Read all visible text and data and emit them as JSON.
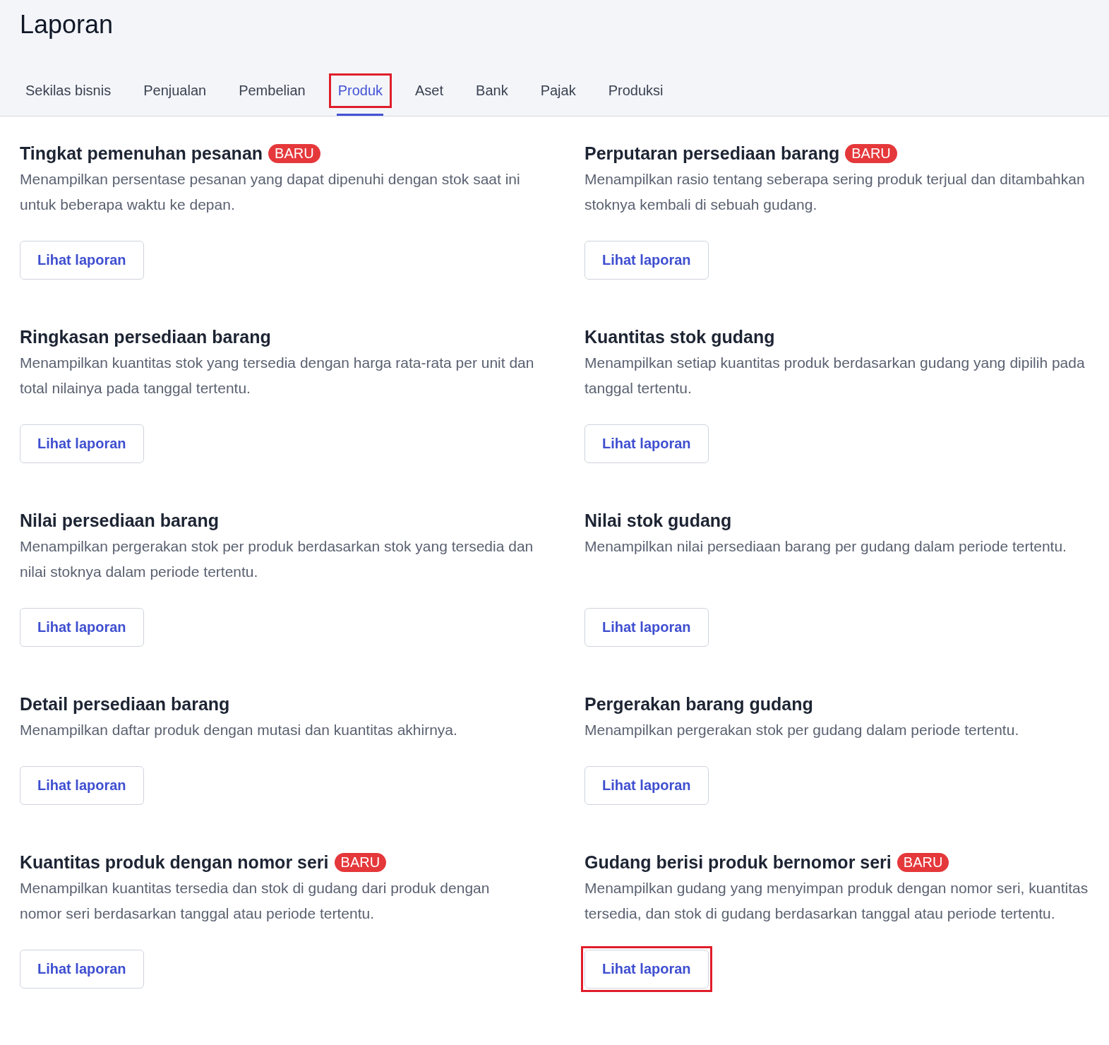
{
  "page": {
    "title": "Laporan"
  },
  "tabs": [
    {
      "label": "Sekilas bisnis",
      "selected": false,
      "highlighted": false
    },
    {
      "label": "Penjualan",
      "selected": false,
      "highlighted": false
    },
    {
      "label": "Pembelian",
      "selected": false,
      "highlighted": false
    },
    {
      "label": "Produk",
      "selected": true,
      "highlighted": true
    },
    {
      "label": "Aset",
      "selected": false,
      "highlighted": false
    },
    {
      "label": "Bank",
      "selected": false,
      "highlighted": false
    },
    {
      "label": "Pajak",
      "selected": false,
      "highlighted": false
    },
    {
      "label": "Produksi",
      "selected": false,
      "highlighted": false
    }
  ],
  "reports": [
    {
      "title": "Tingkat pemenuhan pesanan",
      "badge": "BARU",
      "description": "Menampilkan persentase pesanan yang dapat dipenuhi dengan stok saat ini untuk beberapa waktu ke depan.",
      "button": "Lihat laporan",
      "highlighted": false
    },
    {
      "title": "Perputaran persediaan barang",
      "badge": "BARU",
      "description": "Menampilkan rasio tentang seberapa sering produk terjual dan ditambahkan stoknya kembali di sebuah gudang.",
      "button": "Lihat laporan",
      "highlighted": false
    },
    {
      "title": "Ringkasan persediaan barang",
      "description": "Menampilkan kuantitas stok yang tersedia dengan harga rata-rata per unit dan total nilainya pada tanggal tertentu.",
      "button": "Lihat laporan",
      "highlighted": false
    },
    {
      "title": "Kuantitas stok gudang",
      "description": "Menampilkan setiap kuantitas produk berdasarkan gudang yang dipilih pada tanggal tertentu.",
      "button": "Lihat laporan",
      "highlighted": false
    },
    {
      "title": "Nilai persediaan barang",
      "description": "Menampilkan pergerakan stok per produk berdasarkan stok yang tersedia dan nilai stoknya dalam periode tertentu.",
      "button": "Lihat laporan",
      "highlighted": false
    },
    {
      "title": "Nilai stok gudang",
      "description": "Menampilkan nilai persediaan barang per gudang dalam periode tertentu.",
      "button": "Lihat laporan",
      "highlighted": false
    },
    {
      "title": "Detail persediaan barang",
      "description": "Menampilkan daftar produk dengan mutasi dan kuantitas akhirnya.",
      "button": "Lihat laporan",
      "highlighted": false
    },
    {
      "title": "Pergerakan barang gudang",
      "description": "Menampilkan pergerakan stok per gudang dalam periode tertentu.",
      "button": "Lihat laporan",
      "highlighted": false
    },
    {
      "title": "Kuantitas produk dengan nomor seri",
      "badge": "BARU",
      "description": "Menampilkan kuantitas tersedia dan stok di gudang dari produk dengan nomor seri berdasarkan tanggal atau periode tertentu.",
      "button": "Lihat laporan",
      "highlighted": false
    },
    {
      "title": "Gudang berisi produk bernomor seri",
      "badge": "BARU",
      "description": "Menampilkan gudang yang menyimpan produk dengan nomor seri, kuantitas tersedia, dan stok di gudang berdasarkan tanggal atau periode tertentu.",
      "button": "Lihat laporan",
      "highlighted": true
    }
  ]
}
